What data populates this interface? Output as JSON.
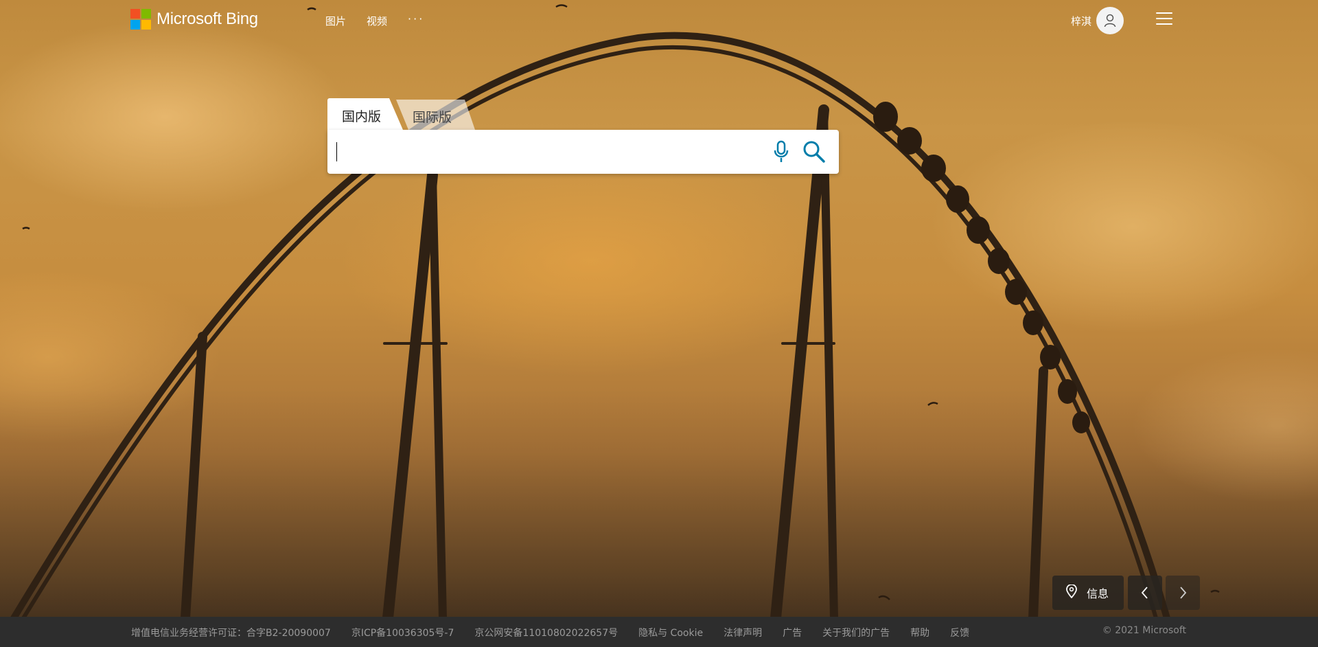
{
  "brand": {
    "name": "Microsoft Bing",
    "tile_colors": [
      "#f25022",
      "#7fba00",
      "#00a4ef",
      "#ffb900"
    ]
  },
  "nav": {
    "images": "图片",
    "videos": "视频",
    "more": "···"
  },
  "user": {
    "name": "梓淇",
    "avatar_icon": "person-icon"
  },
  "menu_icon": "hamburger-menu-icon",
  "search": {
    "tab_domestic": "国内版",
    "tab_international": "国际版",
    "value": "",
    "mic_icon": "microphone-icon",
    "search_icon": "magnifier-icon",
    "accent": "#007daa"
  },
  "controls": {
    "info_label": "信息",
    "info_icon": "location-pin-icon",
    "prev_icon": "chevron-left-icon",
    "next_icon": "chevron-right-icon"
  },
  "footer": {
    "links": [
      "增值电信业务经营许可证：合字B2-20090007",
      "京ICP备10036305号-7",
      "京公网安备11010802022657号",
      "隐私与 Cookie",
      "法律声明",
      "广告",
      "关于我们的广告",
      "帮助",
      "反馈"
    ],
    "copyright": "© 2021 Microsoft"
  }
}
